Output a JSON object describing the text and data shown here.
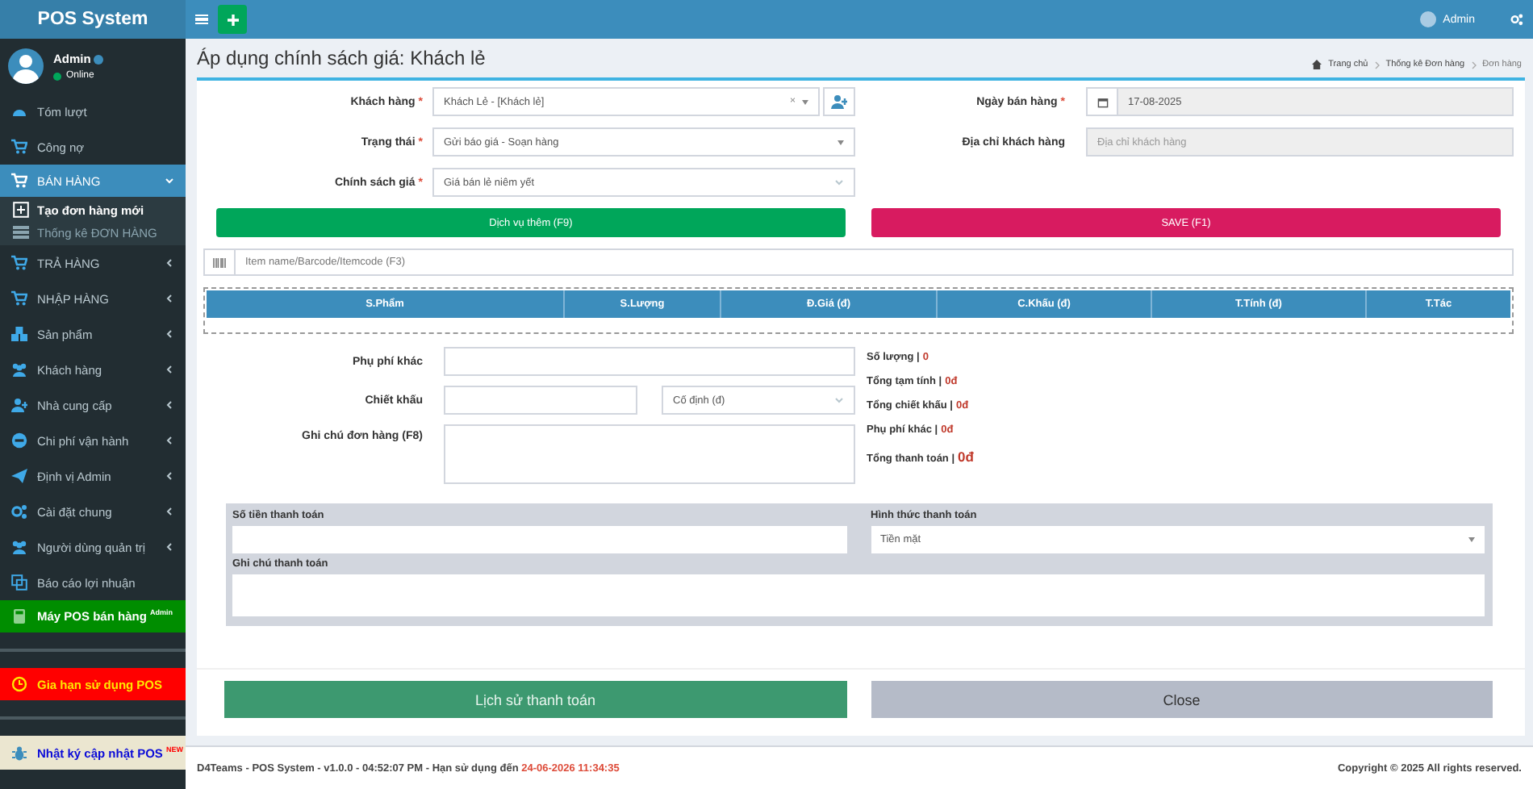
{
  "app": {
    "title": "POS System"
  },
  "user": {
    "name": "Admin",
    "status": "Online"
  },
  "sidebar": {
    "items": [
      {
        "kind": "link",
        "label": "Tóm lượt",
        "selected": false
      },
      {
        "kind": "link",
        "label": "Công nợ",
        "selected": false
      },
      {
        "kind": "group",
        "label": "BÁN HÀNG",
        "selected": true,
        "expanded": true,
        "children": [
          {
            "label": "Tạo đơn hàng mới",
            "selected": true
          },
          {
            "label": "Thống kê ĐƠN HÀNG",
            "selected": false
          }
        ]
      },
      {
        "kind": "group",
        "label": "TRẢ HÀNG",
        "selected": false,
        "expanded": false
      },
      {
        "kind": "group",
        "label": "NHẬP HÀNG",
        "selected": false,
        "expanded": false
      },
      {
        "kind": "group",
        "label": "Sản phẩm",
        "selected": false,
        "expanded": false
      },
      {
        "kind": "group",
        "label": "Khách hàng",
        "selected": false,
        "expanded": false
      },
      {
        "kind": "group",
        "label": "Nhà cung cấp",
        "selected": false,
        "expanded": false
      },
      {
        "kind": "group",
        "label": "Chi phí vận hành",
        "selected": false,
        "expanded": false
      },
      {
        "kind": "group",
        "label": "Định vị Admin",
        "selected": false,
        "expanded": false
      },
      {
        "kind": "group",
        "label": "Cài đặt chung",
        "selected": false,
        "expanded": false
      },
      {
        "kind": "group",
        "label": "Người dùng quản trị",
        "selected": false,
        "expanded": false
      },
      {
        "kind": "link",
        "label": "Báo cáo lợi nhuận",
        "selected": false
      },
      {
        "kind": "pos",
        "label": "Máy POS bán hàng $^{Admin}$",
        "selected": false
      },
      {
        "kind": "renewal",
        "label": "Gia hạn sử dụng POS",
        "selected": false
      },
      {
        "kind": "changelog",
        "label": "Nhật ký cập nhật POS $^{NEW}$",
        "selected": false
      }
    ]
  },
  "header": {
    "user": "Admin"
  },
  "page": {
    "title": "Áp dụng chính sách giá: Khách lẻ",
    "breadcrumb": [
      "Trang chủ",
      "Thống kê Đơn hàng",
      "Đơn hàng"
    ]
  },
  "order_form": {
    "left": [
      {
        "label": "Khách hàng",
        "mark": "*",
        "kind": "customer",
        "value": "Khách Lẻ - [Khách lẻ]",
        "clear_symbol": "×",
        "disabled": false
      },
      {
        "label": "Trạng thái",
        "mark": "*",
        "kind": "select2",
        "value": "Gửi báo giá - Soạn hàng",
        "disabled": false
      },
      {
        "label": "Chính sách giá",
        "mark": "*",
        "kind": "select",
        "value": "Giá bán lẻ niêm yết",
        "disabled": false
      }
    ],
    "right": [
      {
        "label": "Ngày bán hàng",
        "mark": "*",
        "kind": "date",
        "value": "17-08-2025",
        "disabled": true
      },
      {
        "label": "Địa chỉ khách hàng",
        "kind": "text",
        "placeholder": "Địa chỉ khách hàng",
        "disabled": true
      }
    ]
  },
  "actions_top": [
    {
      "kind": "service",
      "label": "Dịch vụ thêm (F9)"
    },
    {
      "kind": "save",
      "label": "SAVE (F1)"
    }
  ],
  "item_search": {
    "placeholder": "Item name/Barcode/Itemcode (F3)"
  },
  "table": {
    "columns": [
      "S.Phẩm",
      "S.Lượng",
      "Đ.Giá (đ)",
      "C.Khấu (đ)",
      "T.Tính (đ)",
      "T.Tác"
    ]
  },
  "charges": [
    {
      "kind": "text",
      "label": "Phụ phí khác"
    },
    {
      "kind": "discount",
      "label": "Chiết khấu",
      "option": "Cố định (đ)"
    },
    {
      "kind": "textarea",
      "label": "Ghi chú đơn hàng (F8)"
    }
  ],
  "summary": [
    {
      "kind": "line",
      "label": "Số lượng |",
      "value": "0"
    },
    {
      "kind": "line",
      "label": "Tổng tạm tính |",
      "value": "0đ"
    },
    {
      "kind": "line",
      "label": "Tổng chiết khấu |",
      "value": "0đ"
    },
    {
      "kind": "line",
      "label": "Phụ phí khác |",
      "value": "0đ"
    },
    {
      "kind": "total",
      "label": "Tổng thanh toán |",
      "value": "0đ"
    }
  ],
  "payment": {
    "amount_label": "Số tiền thanh toán",
    "method_label": "Hình thức thanh toán",
    "method": "Tiền mặt",
    "note_label": "Ghi chú thanh toán"
  },
  "actions_bottom": [
    {
      "kind": "history",
      "label": "Lịch sử thanh toán"
    },
    {
      "kind": "close",
      "label": "Close"
    }
  ],
  "footer": {
    "info": "D4Teams - POS System - v1.0.0 - 04:52:07 PM - Hạn sử dụng đến",
    "expiry": "24-06-2026 11:34:35",
    "copyright": "Copyright © 2025 All rights reserved."
  }
}
